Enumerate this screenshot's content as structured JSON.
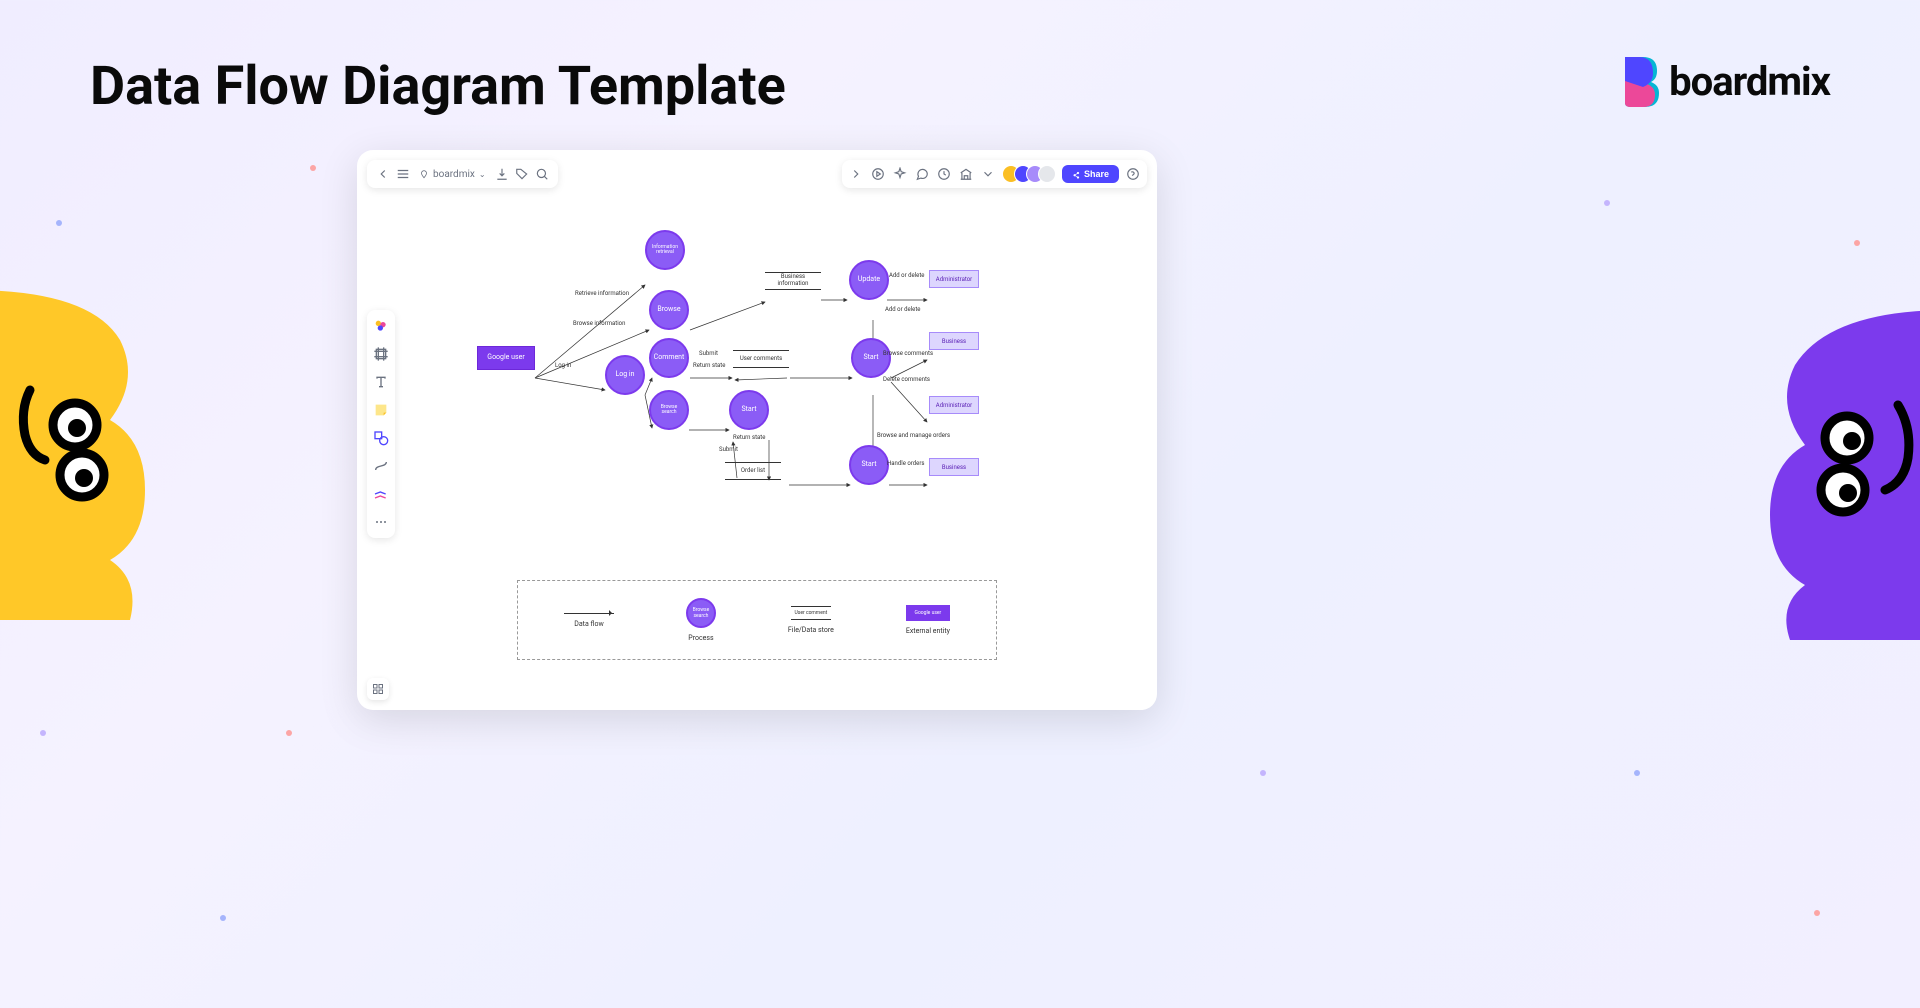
{
  "page": {
    "title": "Data Flow Diagram Template"
  },
  "brand": {
    "name": "boardmix"
  },
  "app": {
    "breadcrumb": "boardmix",
    "share_label": "Share"
  },
  "diagram": {
    "nodes": {
      "google_user": "Google user",
      "info_retrieval": "Information retrieval",
      "browse": "Browse",
      "comment": "Comment",
      "log_in": "Log in",
      "browse_search": "Browse search",
      "start1": "Start",
      "update": "Update",
      "start2": "Start",
      "start3": "Start"
    },
    "stores": {
      "business_info": "Business information",
      "user_comments": "User comments",
      "order_list": "Order list"
    },
    "entities": {
      "admin1": "Administrator",
      "business1": "Business",
      "admin2": "Administrator",
      "business2": "Business"
    },
    "edges": {
      "retrieve_info": "Retrieve information",
      "browse_info": "Browse information",
      "log_in": "Log in",
      "submit": "Submit",
      "return_state": "Return state",
      "return_state2": "Return state",
      "submit2": "Submit",
      "add_delete1": "Add or delete",
      "add_delete2": "Add or delete",
      "browse_comments": "Browse comments",
      "delete_comments": "Delete comments",
      "browse_manage": "Browse and manage orders",
      "handle_orders": "Handle orders"
    }
  },
  "legend": {
    "data_flow": "Data flow",
    "process": "Process",
    "process_sample": "Browse search",
    "store": "File/Data store",
    "store_sample": "User comment",
    "entity": "External entity",
    "entity_sample": "Google user"
  },
  "colors": {
    "purple": "#7c3aed",
    "purple_light": "#8b5cf6",
    "yellow": "#ffc828",
    "brand_blue": "#4f46ff"
  }
}
